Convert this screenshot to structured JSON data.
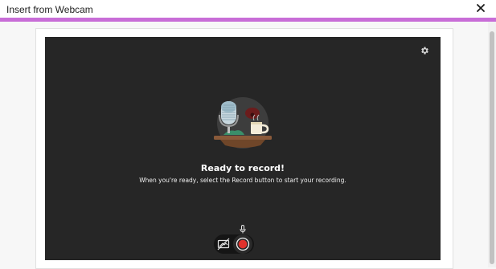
{
  "dialog": {
    "title": "Insert from Webcam",
    "accent_color": "#c86dd7"
  },
  "recorder": {
    "heading": "Ready to record!",
    "instructions": "When you're ready, select the Record button to start your recording.",
    "record_color": "#e0312b",
    "stage_color": "#262626"
  },
  "icons": {
    "close": "close-icon",
    "settings": "gear-icon",
    "microphone": "microphone-icon",
    "camera_off": "camera-off-icon",
    "record": "record-icon"
  }
}
